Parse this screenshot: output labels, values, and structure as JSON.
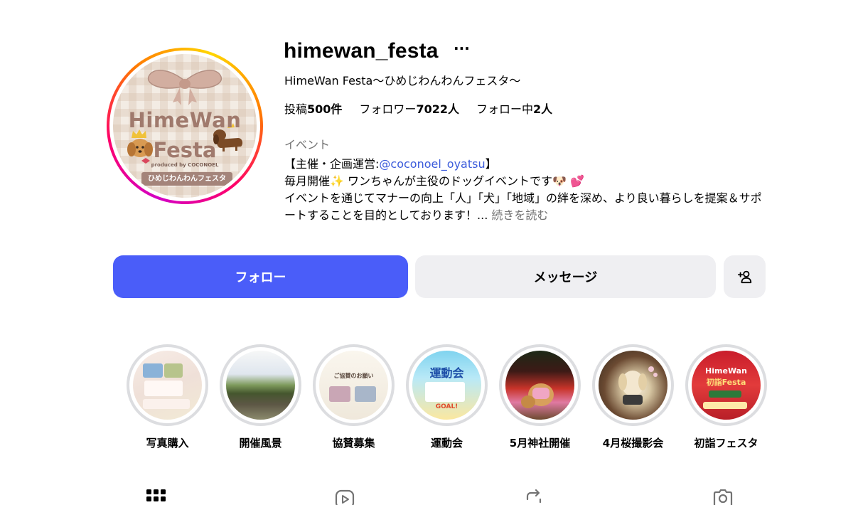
{
  "profile": {
    "username": "himewan_festa",
    "more_label": "···",
    "full_name": "HimeWan Festa〜ひめじわんわんフェスタ〜",
    "stats": {
      "posts_label": "投稿",
      "posts_value": "500件",
      "followers_label": "フォロワー",
      "followers_value": "7022人",
      "following_label": "フォロー中",
      "following_value": "2人"
    },
    "category": "イベント",
    "bio": {
      "line1_prefix": "【主催・企画運営:",
      "line1_mention": "@coconoel_oyatsu",
      "line1_suffix": "】",
      "line2": "毎月開催✨ ワンちゃんが主役のドッグイベントです🐶 💕",
      "line3": "イベントを通じてマナーの向上「人」「犬」「地域」の絆を深め、より良い暮らしを提案＆サポートすることを目的としております！...",
      "more_link": "続きを読む"
    }
  },
  "avatar": {
    "logo_line1": "HimeWan",
    "logo_line2": "Festa",
    "logo_line3": "produced by COCONOEL",
    "logo_band": "ひめじわんわんフェスタ",
    "accent_color": "#a07a6d"
  },
  "actions": {
    "follow_label": "フォロー",
    "message_label": "メッセージ",
    "follow_color": "#4a5df9"
  },
  "highlights": [
    {
      "label": "写真購入"
    },
    {
      "label": "開催風景"
    },
    {
      "label": "協賛募集",
      "thumb_text": "ご協賛のお願い"
    },
    {
      "label": "運動会",
      "thumb_text": "運動会",
      "thumb_badge": "GOAL!"
    },
    {
      "label": "5月神社開催"
    },
    {
      "label": "4月桜撮影会"
    },
    {
      "label": "初詣フェスタ",
      "thumb_text": "HimeWan",
      "thumb_text2": "初詣Festa"
    }
  ],
  "tabs": [
    {
      "icon": "grid-icon"
    },
    {
      "icon": "reels-icon"
    },
    {
      "icon": "repost-icon"
    },
    {
      "icon": "tagged-icon"
    }
  ]
}
